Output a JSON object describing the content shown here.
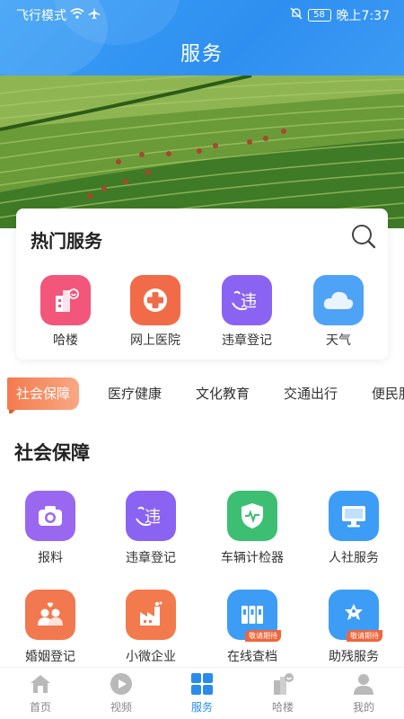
{
  "status_bar": {
    "airplane_mode": "飞行模式",
    "battery": "58",
    "time": "晚上7:37"
  },
  "header": {
    "title": "服务"
  },
  "hot_services": {
    "title": "热门服务",
    "items": [
      {
        "label": "哈楼",
        "icon": "building-icon",
        "color": "#f2567a"
      },
      {
        "label": "网上医院",
        "icon": "medical-cross-icon",
        "color": "#f26b48"
      },
      {
        "label": "违章登记",
        "icon": "violation-icon",
        "color": "#8a63f2"
      },
      {
        "label": "天气",
        "icon": "cloud-icon",
        "color": "#4fa3f6"
      }
    ]
  },
  "category_tabs": [
    "社会保障",
    "医疗健康",
    "文化教育",
    "交通出行",
    "便民服"
  ],
  "section": {
    "title": "社会保障",
    "items": [
      {
        "label": "报料",
        "icon": "camera-icon",
        "color": "#9a68f0",
        "badge": ""
      },
      {
        "label": "违章登记",
        "icon": "violation-icon",
        "color": "#8a63f2",
        "badge": ""
      },
      {
        "label": "车辆计检器",
        "icon": "shield-pulse-icon",
        "color": "#3cbf73",
        "badge": ""
      },
      {
        "label": "人社服务",
        "icon": "monitor-icon",
        "color": "#3d9cf5",
        "badge": ""
      },
      {
        "label": "婚姻登记",
        "icon": "couple-icon",
        "color": "#f2784f",
        "badge": ""
      },
      {
        "label": "小微企业",
        "icon": "factory-icon",
        "color": "#f27a4c",
        "badge": ""
      },
      {
        "label": "在线查档",
        "icon": "archive-icon",
        "color": "#3d9cf5",
        "badge": "敬请期待"
      },
      {
        "label": "助残服务",
        "icon": "accessibility-icon",
        "color": "#3d9cf5",
        "badge": "敬请期待"
      }
    ]
  },
  "tab_bar": {
    "items": [
      {
        "label": "首页",
        "icon": "home-icon"
      },
      {
        "label": "视频",
        "icon": "play-icon"
      },
      {
        "label": "服务",
        "icon": "grid-icon",
        "active": true
      },
      {
        "label": "哈楼",
        "icon": "building-icon"
      },
      {
        "label": "我的",
        "icon": "user-icon"
      }
    ],
    "active_color": "#2a8bef"
  }
}
